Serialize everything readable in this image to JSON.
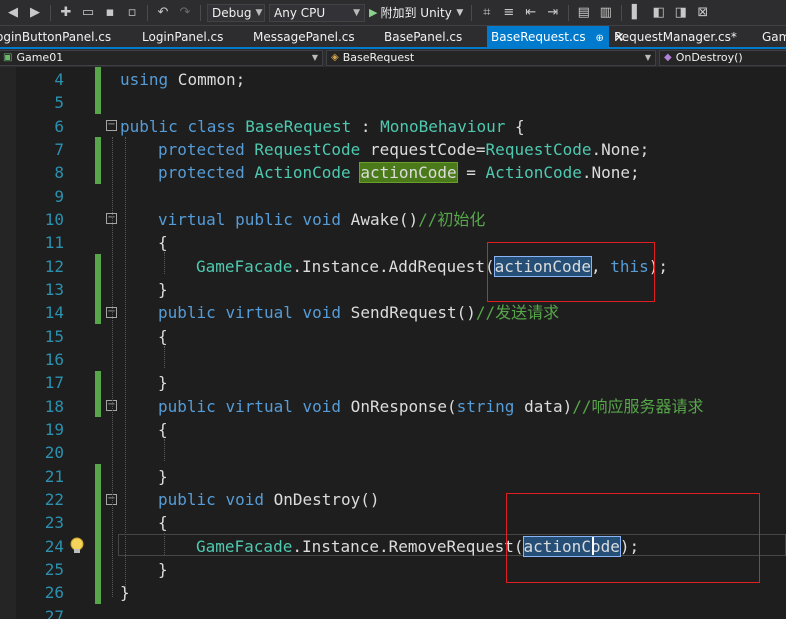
{
  "toolbar": {
    "config_select": "Debug",
    "platform_select": "Any CPU",
    "attach_label": "附加到 Unity"
  },
  "tabs": [
    {
      "label": "oginButtonPanel.cs"
    },
    {
      "label": "LoginPanel.cs"
    },
    {
      "label": "MessagePanel.cs"
    },
    {
      "label": "BasePanel.cs"
    },
    {
      "label": "BaseRequest.cs",
      "pin": "⊕",
      "close": "×"
    },
    {
      "label": "RequestManager.cs*"
    },
    {
      "label": "Gam"
    }
  ],
  "nav": {
    "project": "Game01",
    "class": "BaseRequest",
    "member": "OnDestroy()"
  },
  "editor": {
    "line_numbers": [
      "4",
      "5",
      "6",
      "7",
      "8",
      "9",
      "10",
      "11",
      "12",
      "13",
      "14",
      "15",
      "16",
      "17",
      "18",
      "19",
      "20",
      "21",
      "22",
      "23",
      "24",
      "25",
      "26",
      "27"
    ],
    "fold_glyph": "−",
    "lines": {
      "l4": {
        "kw": "using",
        "rest": " Common;"
      },
      "l6": {
        "kw1": "public",
        "kw2": "class",
        "name": "BaseRequest",
        "colon": " : ",
        "base": "MonoBehaviour",
        "brace": " {"
      },
      "l7": {
        "kw": "protected",
        "type1": "RequestCode",
        "var": " requestCode=",
        "type2": "RequestCode",
        "rest": ".None;"
      },
      "l8": {
        "kw": "protected",
        "type": "ActionCode",
        "sel": "actionCode",
        "eq": " = ",
        "type2": "ActionCode",
        "rest": ".None;"
      },
      "l10": {
        "kw1": "virtual",
        "kw2": "public",
        "kw3": "void",
        "name": " Awake()",
        "comment": "//初始化"
      },
      "l11": {
        "text": "{"
      },
      "l12": {
        "type": "GameFacade",
        "mid": ".Instance.AddRequest(",
        "sel": "actionCode",
        "comma": ", ",
        "kw": "this",
        "end": ");"
      },
      "l13": {
        "text": "}"
      },
      "l14": {
        "kw1": "public",
        "kw2": "virtual",
        "kw3": "void",
        "name": " SendRequest()",
        "comment": "//发送请求"
      },
      "l15": {
        "text": "{"
      },
      "l17": {
        "text": "}"
      },
      "l18": {
        "kw1": "public",
        "kw2": "virtual",
        "kw3": "void",
        "name": " OnResponse(",
        "kw4": "string",
        "param": " data)",
        "comment": "//响应服务器请求"
      },
      "l19": {
        "text": "{"
      },
      "l21": {
        "text": "}"
      },
      "l22": {
        "kw1": "public",
        "kw2": "void",
        "name": " OnDestroy()"
      },
      "l23": {
        "text": "{"
      },
      "l24": {
        "type": "GameFacade",
        "mid": ".Instance.RemoveRequest(",
        "sel": "actionCode",
        "end": ");"
      },
      "l25": {
        "text": "}"
      },
      "l26": {
        "text": "}"
      }
    }
  },
  "colors": {
    "keyword": "#569cd6",
    "type": "#4ec9b0",
    "comment": "#57a64a",
    "line_number": "#2b91af",
    "accent": "#007acc",
    "annotation_box": "#e02020"
  }
}
